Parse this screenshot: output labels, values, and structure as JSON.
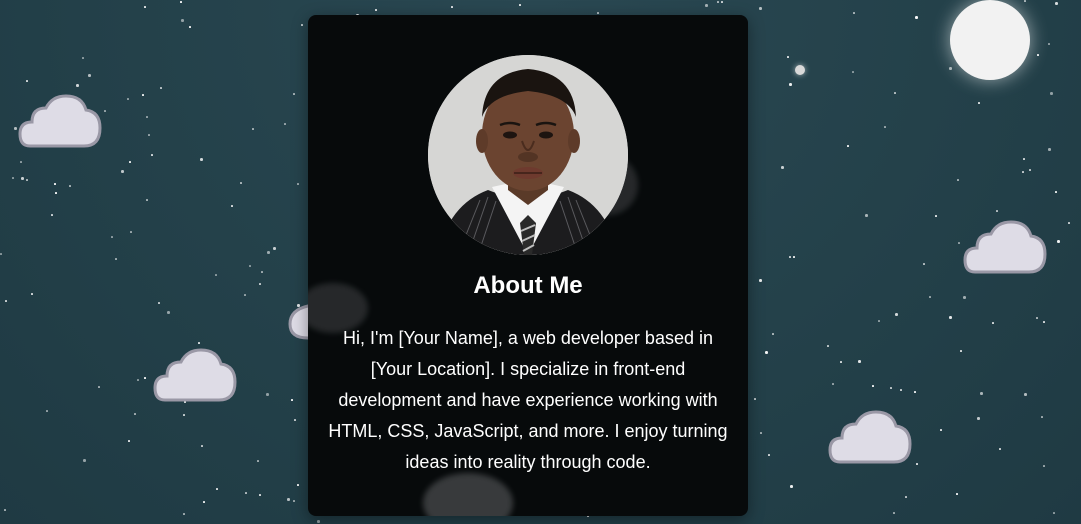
{
  "colors": {
    "background": "#26434c",
    "card": "#070a0b",
    "text": "#ffffff",
    "cloud": "#dedce6",
    "cloud_outline": "#9a98a6",
    "moon": "#f2f2f2"
  },
  "profile": {
    "photo_icon": "profile-photo",
    "title": "About Me",
    "bio": "Hi, I'm [Your Name], a web developer based in [Your Location]. I specialize in front-end development and have experience working with HTML, CSS, JavaScript, and more. I enjoy turning ideas into reality through code."
  }
}
